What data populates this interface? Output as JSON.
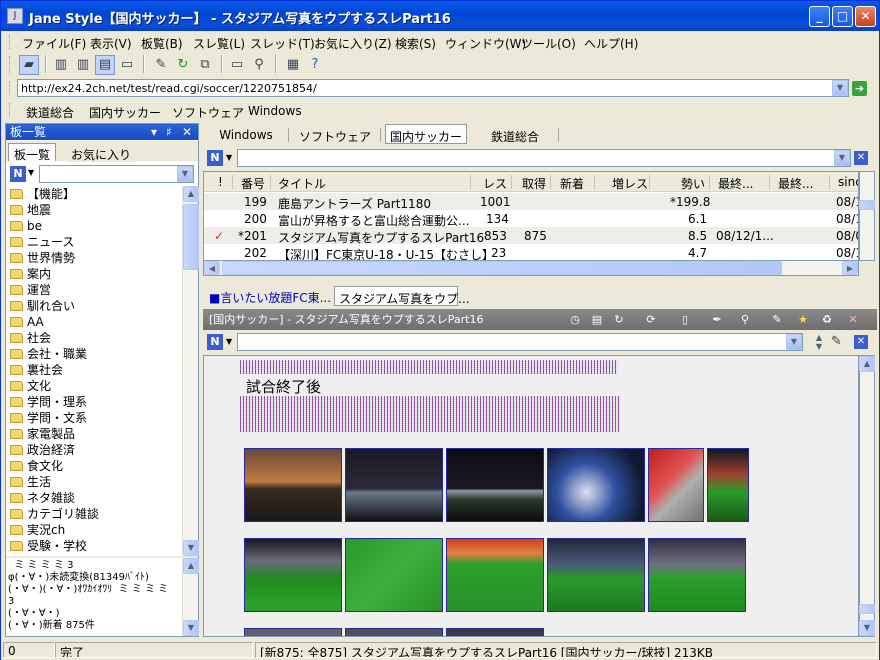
{
  "window": {
    "title": "Jane Style【国内サッカー】 - スタジアム写真をウプするスレPart16",
    "app_icon": "J",
    "minimize": "_",
    "maximize": "□",
    "close": "✕"
  },
  "menu": [
    "ファイル(F)",
    "表示(V)",
    "板覧(B)",
    "スレ覧(L)",
    "スレッド(T)",
    "お気に入り(Z)",
    "検索(S)",
    "ウィンドウ(W)",
    "ツール(O)",
    "ヘルプ(H)"
  ],
  "toolbar_icons": [
    "brush-icon",
    "pane-left-icon",
    "pane-split-icon",
    "pane-right-icon",
    "pane-full-icon",
    "edit-icon",
    "refresh-icon",
    "copy-icon",
    "comment-icon",
    "search-icon",
    "board-icon",
    "help-icon"
  ],
  "address": {
    "url": "http://ex24.2ch.net/test/read.cgi/soccer/1220751854/"
  },
  "links": [
    "鉄道総合",
    "国内サッカー",
    "ソフトウェア",
    "Windows"
  ],
  "board_panel": {
    "title": "板一覧",
    "tab_boards": "板一覧",
    "tab_favorites": "お気に入り",
    "filter_icon": "N",
    "items": [
      "【機能】",
      "地震",
      "be",
      "ニュース",
      "世界情勢",
      "案内",
      "運営",
      "馴れ合い",
      "AA",
      "社会",
      "会社・職業",
      "裏社会",
      "文化",
      "学問・理系",
      "学問・文系",
      "家電製品",
      "政治経済",
      "食文化",
      "生活",
      "ネタ雑談",
      "カテゴリ雑談",
      "実況ch",
      "受験・学校"
    ],
    "log": "  ミ ミ ミ ミ 3\nφ(・∀・)未読変換(81349ﾊﾞｲﾄ)\n(・∀・)(・∀・)ｵﾜｶｲｵﾜﾘ  ミ ミ ミ ミ\n3\n(・∀・∀・)\n(・∀・)新着 875件"
  },
  "board_tabs": [
    "Windows",
    "ソフトウェア",
    "国内サッカー",
    "鉄道総合"
  ],
  "thread_list": {
    "headers": [
      "!",
      "番号",
      "タイトル",
      "レス",
      "取得",
      "新着",
      "増レス",
      "勢い",
      "最終...",
      "最終...",
      "sinc"
    ],
    "rows": [
      {
        "mark": "",
        "no": "199",
        "title": "鹿島アントラーズ Part1180",
        "res": "1001",
        "got": "",
        "new": "",
        "inc": "",
        "speed": "*199.8",
        "last1": "",
        "last2": "",
        "since": "08/1"
      },
      {
        "mark": "",
        "no": "200",
        "title": "富山が昇格すると富山総合運動公...",
        "res": "134",
        "got": "",
        "new": "",
        "inc": "",
        "speed": "6.1",
        "last1": "",
        "last2": "",
        "since": "08/1"
      },
      {
        "mark": "✓",
        "no": "*201",
        "title": "スタジアム写真をウプするスレPart16",
        "res": "853",
        "got": "875",
        "new": "",
        "inc": "",
        "speed": "8.5",
        "last1": "08/12/1...",
        "last2": "",
        "since": "08/0"
      },
      {
        "mark": "",
        "no": "202",
        "title": "【深川】FC東京U-18・U-15【むさし】",
        "res": "23",
        "got": "",
        "new": "",
        "inc": "",
        "speed": "4.7",
        "last1": "",
        "last2": "",
        "since": "08/1"
      }
    ]
  },
  "viewer_tabs": [
    "■言いたい放題FC東...",
    "スタジアム写真をウプ..."
  ],
  "viewer": {
    "title": "[国内サッカー] - スタジアム写真をウプするスレPart16",
    "post_text": "試合終了後"
  },
  "status": {
    "left": "0",
    "state": "完了",
    "info": "[新875: 全875] スタジアム写真をウプするスレPart16 [国内サッカー/球技] 213KB"
  }
}
